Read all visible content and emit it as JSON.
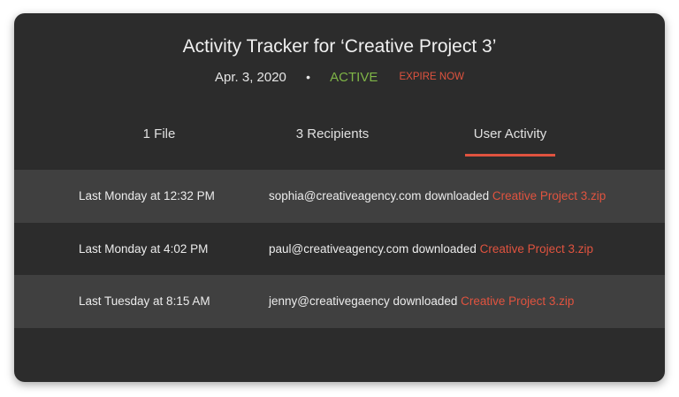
{
  "header": {
    "title": "Activity Tracker for ‘Creative Project 3’",
    "date": "Apr. 3, 2020",
    "separator": "•",
    "status": "ACTIVE",
    "expire_label": "EXPIRE NOW"
  },
  "tabs": [
    {
      "label": "1 File"
    },
    {
      "label": "3 Recipients"
    },
    {
      "label": "User Activity",
      "active": true
    }
  ],
  "activity": [
    {
      "time": "Last Monday at 12:32 PM",
      "user": "sophia@creativeagency.com",
      "action": "downloaded",
      "file": "Creative Project 3.zip"
    },
    {
      "time": "Last Monday at 4:02 PM",
      "user": "paul@creativeagency.com",
      "action": "downloaded",
      "file": "Creative Project 3.zip"
    },
    {
      "time": "Last Tuesday at 8:15 AM",
      "user": "jenny@creativegaency",
      "action": "downloaded",
      "file": "Creative Project 3.zip"
    }
  ],
  "colors": {
    "background": "#2c2c2c",
    "row_alt": "#404040",
    "active_green": "#7fb547",
    "accent_red": "#e0533f"
  }
}
